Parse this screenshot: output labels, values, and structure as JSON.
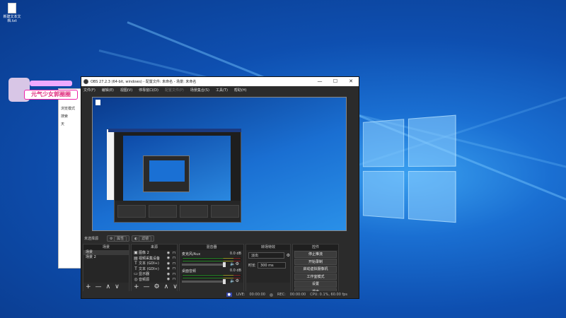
{
  "desktop": {
    "icon_label": "新建文本文档.txt"
  },
  "avatar_tag": "元气少女郭圈圈",
  "back_window": {
    "sidebar": [
      "浏览模式",
      "搜索",
      "天"
    ]
  },
  "obs": {
    "title": "OBS 27.2.3 (64-bit, windows) - 配置文件: 未命名 - 场景: 未命名",
    "window_controls": {
      "min": "—",
      "max": "☐",
      "close": "✕"
    },
    "menu": [
      {
        "label": "文件(F)",
        "enabled": true
      },
      {
        "label": "编辑(E)",
        "enabled": true
      },
      {
        "label": "视图(V)",
        "enabled": true
      },
      {
        "label": "停靠窗口(D)",
        "enabled": true
      },
      {
        "label": "配置文件(P)",
        "enabled": false
      },
      {
        "label": "场景集合(S)",
        "enabled": true
      },
      {
        "label": "工具(T)",
        "enabled": true
      },
      {
        "label": "帮助(H)",
        "enabled": true
      }
    ],
    "no_source": "未选择源",
    "props_btn": "属性",
    "filters_btn": "滤镜",
    "docks": {
      "scenes": {
        "title": "场景",
        "items": [
          "场景",
          "场景 2"
        ]
      },
      "sources": {
        "title": "来源",
        "items": [
          {
            "icon": "▣",
            "name": "图像 2"
          },
          {
            "icon": "▤",
            "name": "视频采集设备"
          },
          {
            "icon": "T",
            "name": "文本 (GDI+)"
          },
          {
            "icon": "T",
            "name": "文本 (GDI+)"
          },
          {
            "icon": "▭",
            "name": "显示器"
          },
          {
            "icon": "◎",
            "name": "音频源"
          }
        ]
      },
      "mixer": {
        "title": "混音器",
        "channels": [
          {
            "name": "麦克风/Aux",
            "db": "0.0 dB",
            "level": 0.7
          },
          {
            "name": "桌面音频",
            "db": "0.0 dB",
            "level": 0.6
          }
        ]
      },
      "transitions": {
        "title": "转场特效",
        "selected": "淡出",
        "duration_label": "时长",
        "duration_value": "300 ms"
      },
      "controls": {
        "title": "控件",
        "buttons": [
          "停止推流",
          "开始录制",
          "启动虚拟摄像机",
          "工作室模式",
          "设置",
          "退出"
        ]
      }
    },
    "toolbar_glyphs": {
      "add": "+",
      "remove": "—",
      "up": "∧",
      "down": "∨",
      "gear": "⚙"
    },
    "status": {
      "live_label": "LIVE:",
      "live_time": "00:00:00",
      "rec_label": "REC:",
      "rec_time": "00:00:00",
      "cpu": "CPU: 0.1%, 60.00 fps"
    }
  }
}
